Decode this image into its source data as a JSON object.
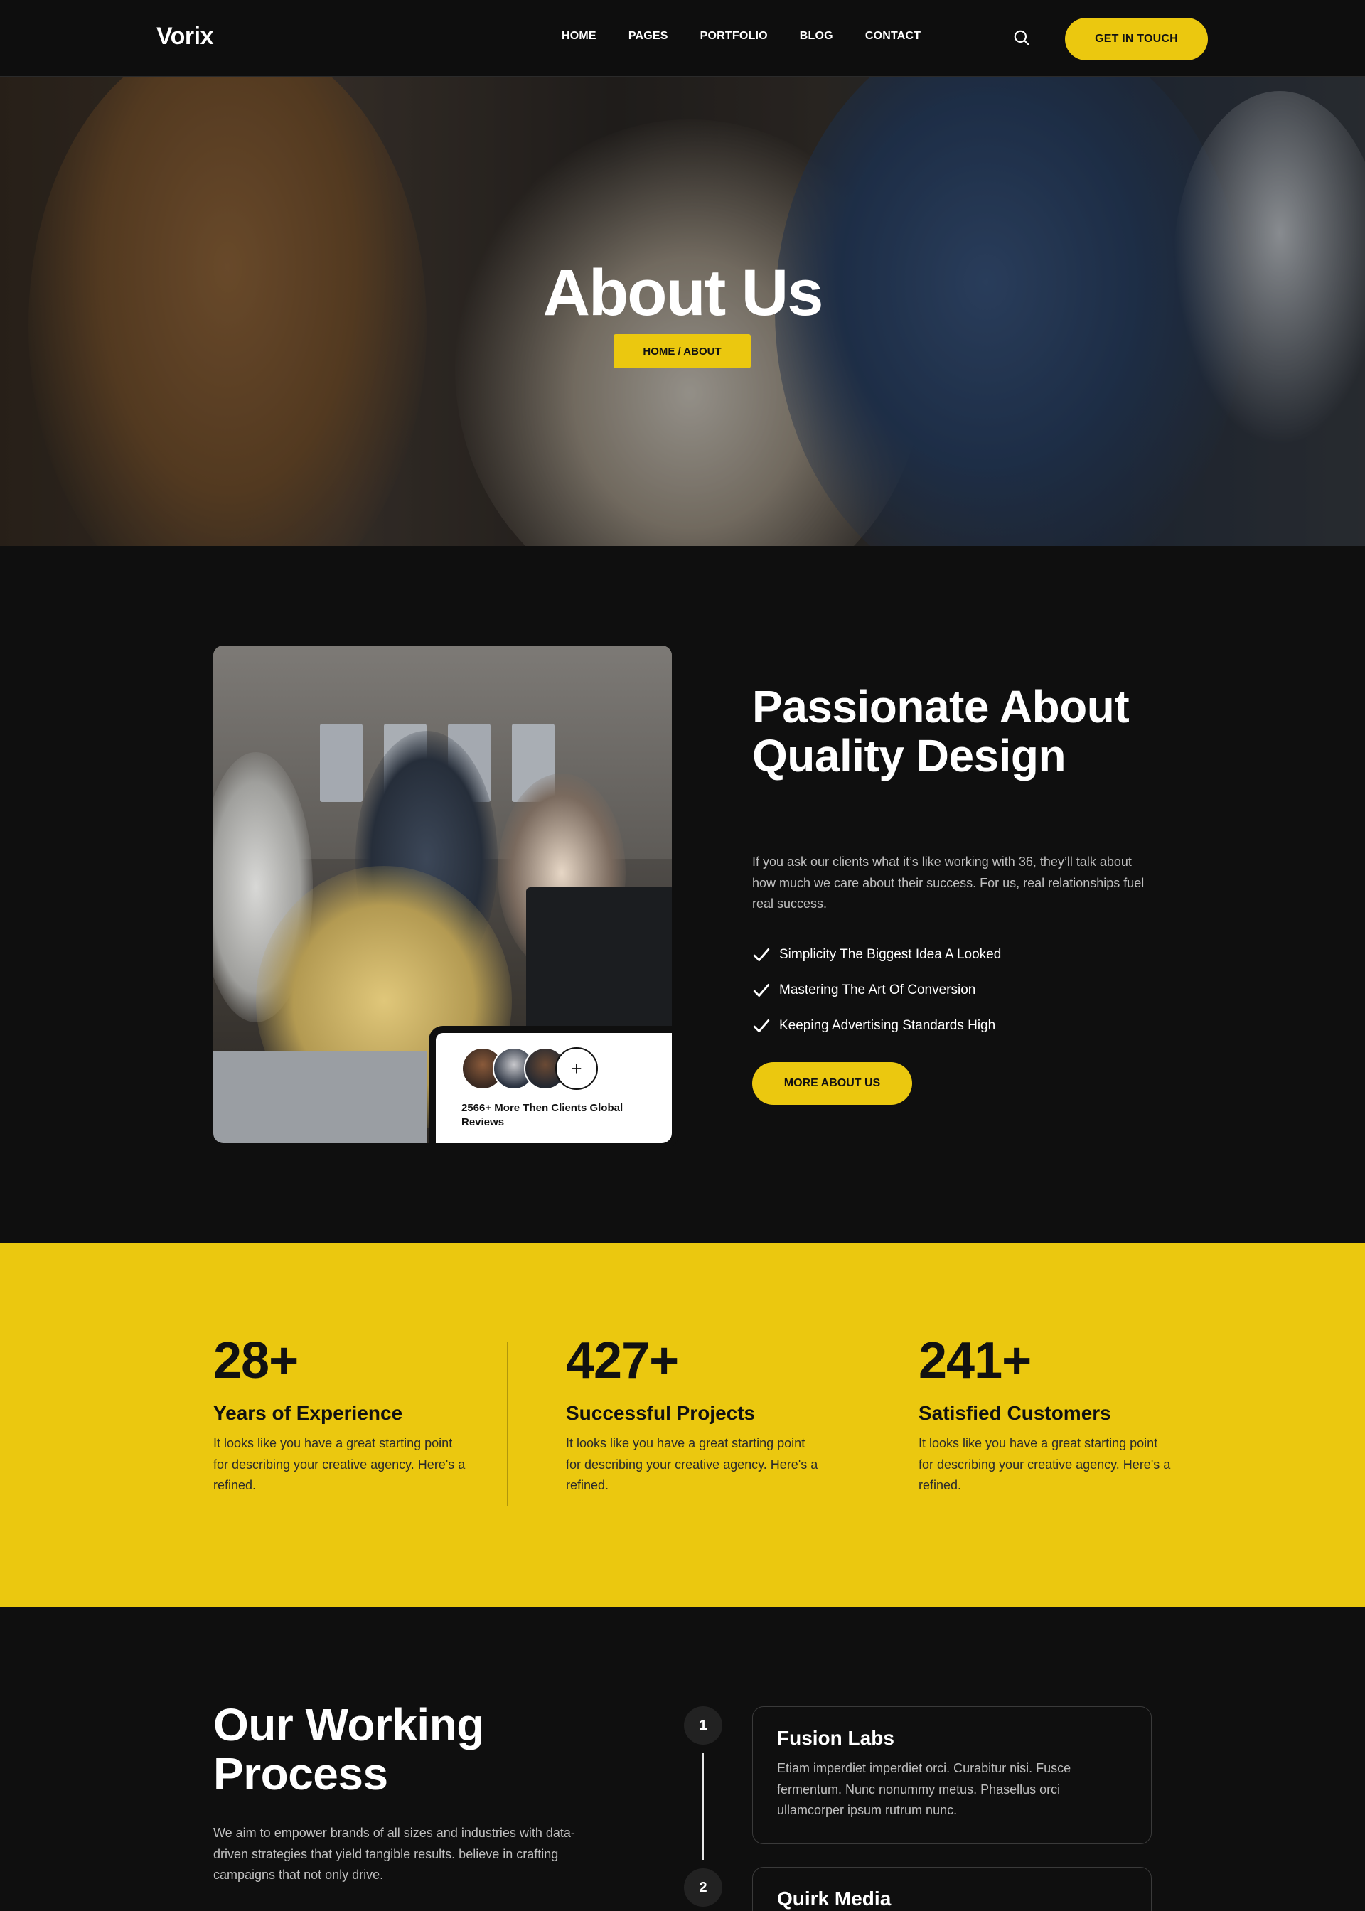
{
  "header": {
    "logo": "Vorix",
    "nav": [
      "HOME",
      "PAGES",
      "PORTFOLIO",
      "BLOG",
      "CONTACT"
    ],
    "cta_label": "GET IN TOUCH"
  },
  "hero": {
    "title": "About Us",
    "breadcrumb": "HOME / ABOUT"
  },
  "about": {
    "title": "Passionate About Quality Design",
    "description": "If you ask our clients what it’s like working with 36, they’ll talk about how much we care about their success. For us, real relationships fuel real success.",
    "checklist": [
      "Simplicity The Biggest Idea A Looked",
      "Mastering The Art Of Conversion",
      "Keeping Advertising Standards High"
    ],
    "button_label": "MORE ABOUT US",
    "review_plus": "+",
    "review_text": "2566+ More Then Clients Global Reviews"
  },
  "stats": [
    {
      "number": "28+",
      "title": "Years of Experience",
      "description": "It looks like you have a great starting point for describing your creative agency. Here's a refined."
    },
    {
      "number": "427+",
      "title": "Successful Projects",
      "description": "It looks like you have a great starting point for describing your creative agency. Here's a refined."
    },
    {
      "number": "241+",
      "title": "Satisfied Customers",
      "description": "It looks like you have a great starting point for describing your creative agency. Here's a refined."
    }
  ],
  "process": {
    "title": "Our Working Process",
    "description": "We aim to empower brands of all sizes and industries with data-driven strategies that yield tangible results. believe in crafting campaigns that not only drive.",
    "steps": [
      {
        "number": "1",
        "title": "Fusion Labs",
        "description": "Etiam imperdiet imperdiet orci. Curabitur nisi. Fusce fermentum. Nunc nonummy metus. Phasellus orci ullamcorper ipsum rutrum nunc."
      },
      {
        "number": "2",
        "title": "Quirk Media",
        "description": ""
      }
    ]
  },
  "colors": {
    "accent": "#ebc80f",
    "background": "#0f0f0f",
    "text": "#ffffff",
    "muted_text": "#bfbfbf"
  },
  "icons": {
    "search": "search-icon",
    "check": "check-icon",
    "plus": "plus-icon"
  }
}
